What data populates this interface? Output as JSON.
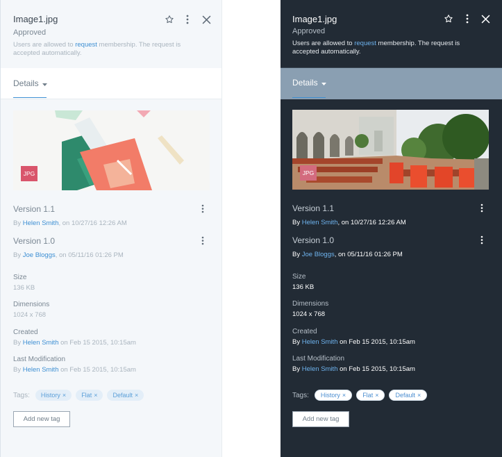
{
  "file": {
    "title": "Image1.jpg",
    "status": "Approved",
    "description_before": "Users are allowed to ",
    "description_link": "request",
    "description_after": " membership. The request is accepted automatically."
  },
  "header_icons": {
    "star": "star-icon",
    "more": "more-vertical-icon",
    "close": "close-icon"
  },
  "tab": {
    "label": "Details",
    "icon": "caret-down-icon"
  },
  "preview": {
    "badge": "JPG"
  },
  "versions": [
    {
      "title": "Version 1.1",
      "prefix": "By ",
      "author": "Helen Smith",
      "suffix": ", on 10/27/16 12:26 AM"
    },
    {
      "title": "Version 1.0",
      "prefix": "By ",
      "author": "Joe Bloggs",
      "suffix": ", on 05/11/16 01:26 PM"
    }
  ],
  "properties": {
    "size": {
      "label": "Size",
      "value": "136 KB"
    },
    "dimensions": {
      "label": "Dimensions",
      "value": "1024 x 768"
    },
    "created": {
      "label": "Created",
      "prefix": "By ",
      "author": "Helen Smith",
      "suffix": " on Feb 15 2015, 10:15am"
    },
    "modified": {
      "label": "Last Modification",
      "prefix": "By ",
      "author": "Helen Smith",
      "suffix": " on Feb 15 2015, 10:15am"
    }
  },
  "tags": {
    "label": "Tags:",
    "items": [
      "History",
      "Flat",
      "Default"
    ],
    "remove_glyph": "×"
  },
  "add_tag_label": "Add new tag",
  "colors": {
    "light_background": "#f4f7fa",
    "dark_background": "#222b35",
    "accent": "#3d8fd3",
    "badge": "#d9556b"
  }
}
